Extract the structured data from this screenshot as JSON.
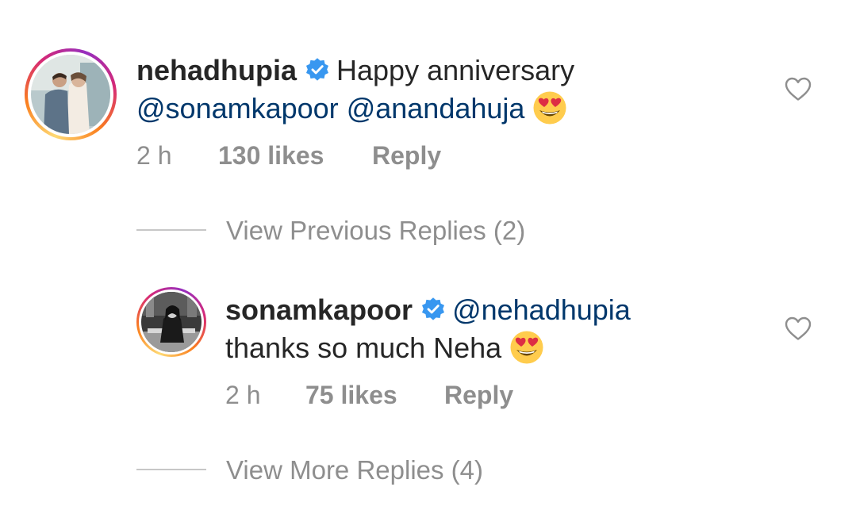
{
  "comment": {
    "username": "nehadhupia",
    "verified_icon": "verified-badge-icon",
    "text_prefix": "Happy anniversary",
    "mention_1": "@sonamkapoor",
    "mention_2": "@anandahuja",
    "emoji": "heart-eyes-emoji",
    "time": "2 h",
    "likes": "130 likes",
    "reply_label": "Reply",
    "like_icon": "heart-outline-icon"
  },
  "view_previous": "View Previous Replies (2)",
  "reply": {
    "username": "sonamkapoor",
    "verified_icon": "verified-badge-icon",
    "mention": "@nehadhupia",
    "text": "thanks so much Neha",
    "emoji": "heart-eyes-emoji",
    "time": "2 h",
    "likes": "75 likes",
    "reply_label": "Reply",
    "like_icon": "heart-outline-icon"
  },
  "view_more": "View More Replies (4)",
  "colors": {
    "text": "#262626",
    "mention": "#00376b",
    "secondary": "#8e8e8e",
    "verified": "#3897f0"
  }
}
